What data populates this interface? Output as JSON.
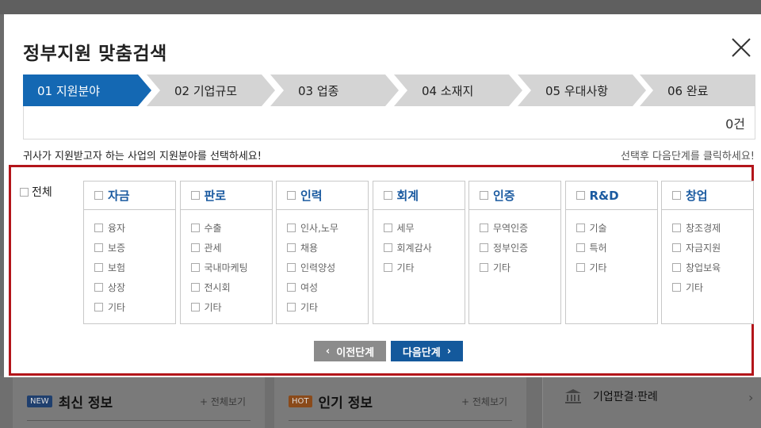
{
  "modal": {
    "title": "정부지원 맞춤검색",
    "steps": [
      {
        "label": "01 지원분야",
        "active": true
      },
      {
        "label": "02 기업규모",
        "active": false
      },
      {
        "label": "03 업종",
        "active": false
      },
      {
        "label": "04 소재지",
        "active": false
      },
      {
        "label": "05 우대사항",
        "active": false
      },
      {
        "label": "06 완료",
        "active": false
      }
    ],
    "count": "0건",
    "instruction": "귀사가 지원받고자 하는 사업의 지원분야를 선택하세요!",
    "hint": "선택후 다음단계를 클릭하세요!",
    "all_label": "전체",
    "categories": [
      {
        "title": "자금",
        "items": [
          "융자",
          "보증",
          "보험",
          "상장",
          "기타"
        ]
      },
      {
        "title": "판로",
        "items": [
          "수출",
          "관세",
          "국내마케팅",
          "전시회",
          "기타"
        ]
      },
      {
        "title": "인력",
        "items": [
          "인사,노무",
          "채용",
          "인력양성",
          "여성",
          "기타"
        ]
      },
      {
        "title": "회계",
        "items": [
          "세무",
          "회계감사",
          "기타"
        ]
      },
      {
        "title": "인증",
        "items": [
          "무역인증",
          "정부인증",
          "기타"
        ]
      },
      {
        "title": "R&D",
        "items": [
          "기술",
          "특허",
          "기타"
        ]
      },
      {
        "title": "창업",
        "items": [
          "창조경제",
          "자금지원",
          "창업보육",
          "기타"
        ]
      }
    ],
    "prev_label": "이전단계",
    "next_label": "다음단계",
    "colors": {
      "active_step": "#1468b3",
      "highlight_border": "#b3151a",
      "next_button": "#14599c"
    }
  },
  "background": {
    "new_badge": "NEW",
    "latest_title": "최신 정보",
    "hot_badge": "HOT",
    "popular_title": "인기 정보",
    "view_all": "전체보기",
    "side_label": "기업판결·판례"
  }
}
